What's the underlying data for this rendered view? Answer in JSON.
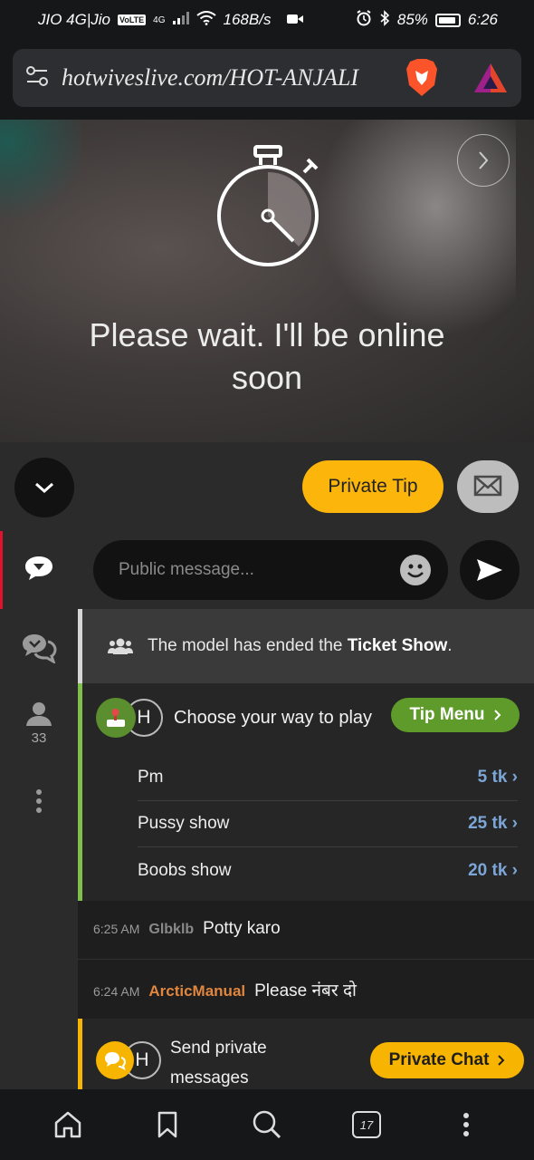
{
  "status_bar": {
    "carrier": "JIO 4G|Jio",
    "volte": "VoLTE",
    "signal": "4G",
    "speed": "168B/s",
    "battery": "85%",
    "time": "6:26"
  },
  "browser": {
    "url": "hotwiveslive.com/HOT-ANJALI",
    "tabs_count": "17"
  },
  "video": {
    "wait_line1": "Please wait. I'll be online",
    "wait_line2": "soon"
  },
  "controls": {
    "private_tip_label": "Private Tip"
  },
  "sidebar": {
    "users_count": "33"
  },
  "message_input": {
    "placeholder": "Public message..."
  },
  "chat": {
    "notice": {
      "prefix": "The model has ended the ",
      "bold": "Ticket Show",
      "suffix": "."
    },
    "tip_menu": {
      "avatar_letter": "H",
      "title": "Choose your way to play",
      "button_label": "Tip Menu",
      "items": [
        {
          "name": "Pm",
          "price": "5 tk"
        },
        {
          "name": "Pussy show",
          "price": "25 tk"
        },
        {
          "name": "Boobs show",
          "price": "20 tk"
        }
      ]
    },
    "messages": [
      {
        "time": "6:25 AM",
        "user": "Glbklb",
        "text": "Potty karo"
      },
      {
        "time": "6:24 AM",
        "user": "ArcticManual",
        "text": "Please नंबर दो"
      }
    ],
    "private_prompt": {
      "avatar_letter": "H",
      "line1": "Send private",
      "line2": "messages",
      "button_label": "Private Chat"
    }
  },
  "icons": {
    "site_settings": "tune-icon",
    "brave": "brave-lion-icon",
    "rewards": "brave-rewards-triangle-icon",
    "timer": "stopwatch-icon",
    "next": "chevron-right-icon",
    "collapse": "chevron-down-icon",
    "mail": "envelope-icon",
    "send": "send-icon",
    "emoji": "emoji-icon",
    "users_group": "users-icon",
    "home": "home-icon",
    "bookmark": "bookmark-icon",
    "search": "search-icon",
    "menu": "more-vertical-icon"
  },
  "colors": {
    "accent_yellow": "#fcb60b",
    "tip_green": "#5f9b2b",
    "active_red": "#e1132c",
    "price_blue": "#7ca6d8",
    "username_orange": "#e0863f"
  }
}
